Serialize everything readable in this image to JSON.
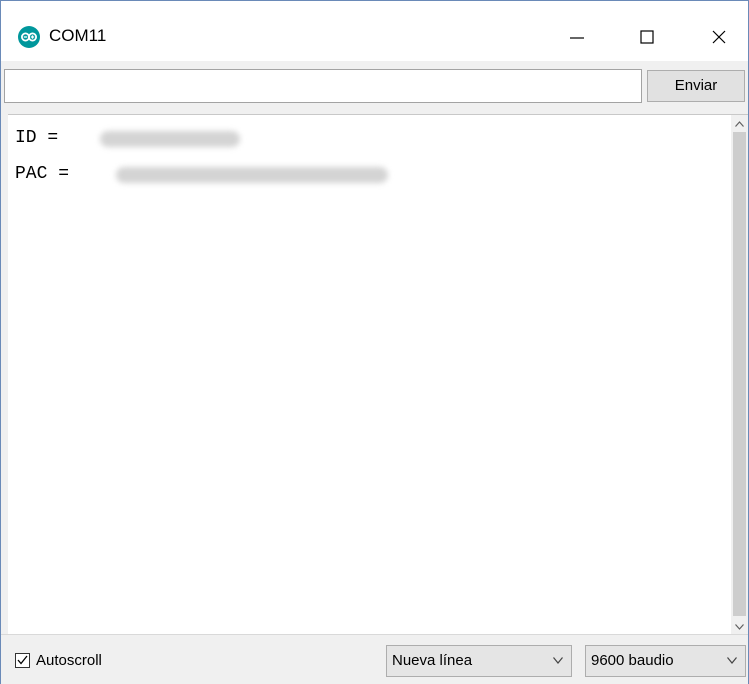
{
  "window": {
    "title": "COM11",
    "icon": "arduino-infinity-icon",
    "controls": [
      "minimize-icon",
      "maximize-icon",
      "close-icon"
    ]
  },
  "send": {
    "input_value": "",
    "button_label": "Enviar"
  },
  "output": {
    "lines": [
      {
        "label": "ID =",
        "value_redacted": true
      },
      {
        "label": "PAC =",
        "value_redacted": true
      }
    ]
  },
  "bottom": {
    "autoscroll_label": "Autoscroll",
    "autoscroll_checked": true,
    "line_ending": "Nueva línea",
    "baud_rate": "9600 baudio"
  },
  "colors": {
    "arduino_teal": "#00979c",
    "window_border": "#6a8ab8",
    "chrome_gray": "#f0f0f0"
  }
}
